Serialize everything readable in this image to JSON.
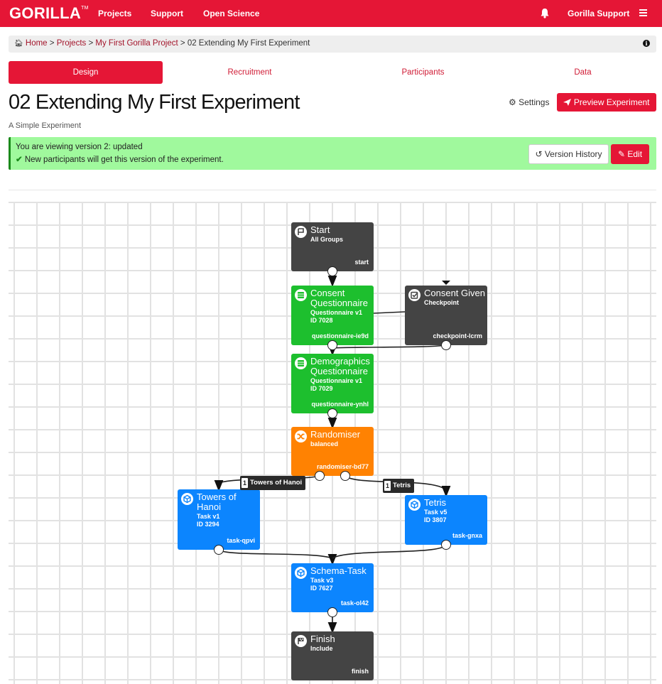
{
  "navbar": {
    "brand": "GORILLA",
    "brand_tm": "TM",
    "links": [
      "Projects",
      "Support",
      "Open Science"
    ],
    "user": "Gorilla Support",
    "bell_icon": "bell-icon",
    "menu_icon": "hamburger-menu-icon"
  },
  "breadcrumb": {
    "home_icon": "home-icon",
    "items": [
      "Home",
      "Projects",
      "My First Gorilla Project"
    ],
    "current": "02 Extending My First Experiment",
    "separator": ">",
    "info_icon": "info-icon"
  },
  "tabs": [
    {
      "label": "Design",
      "active": true
    },
    {
      "label": "Recruitment",
      "active": false
    },
    {
      "label": "Participants",
      "active": false
    },
    {
      "label": "Data",
      "active": false
    }
  ],
  "header": {
    "title": "02 Extending My First Experiment",
    "subtitle": "A Simple Experiment",
    "settings_label": "Settings",
    "preview_label": "Preview Experiment"
  },
  "alert": {
    "line1": "You are viewing version 2: updated",
    "line2": "New participants will get this version of the experiment.",
    "version_history_label": "Version History",
    "edit_label": "Edit"
  },
  "colors": {
    "brand": "#E51636",
    "alert_bg": "#A0F99D",
    "node_dark": "#444444",
    "node_questionnaire": "#1DBF2E",
    "node_randomiser": "#FF8202",
    "node_task": "#0C85FE"
  },
  "nodes": [
    {
      "id": "start",
      "title": "Start",
      "subtitle": "All Groups",
      "key": "start",
      "type": "start"
    },
    {
      "id": "consent",
      "title": "Consent Questionnaire",
      "subtitle": "Questionnaire v1",
      "extra": "ID 7028",
      "key": "questionnaire-ie9d",
      "type": "questionnaire"
    },
    {
      "id": "checkpoint",
      "title": "Consent Given",
      "subtitle": "Checkpoint",
      "key": "checkpoint-lcrm",
      "type": "checkpoint"
    },
    {
      "id": "demographics",
      "title": "Demographics Questionnaire",
      "subtitle": "Questionnaire v1",
      "extra": "ID 7029",
      "key": "questionnaire-ynhl",
      "type": "questionnaire"
    },
    {
      "id": "randomiser",
      "title": "Randomiser",
      "subtitle": "balanced",
      "key": "randomiser-bd77",
      "type": "randomiser"
    },
    {
      "id": "hanoi",
      "title": "Towers of Hanoi",
      "subtitle": "Task v1",
      "extra": "ID 3294",
      "key": "task-qpvi",
      "type": "task"
    },
    {
      "id": "tetris",
      "title": "Tetris",
      "subtitle": "Task v5",
      "extra": "ID 3807",
      "key": "task-gnxa",
      "type": "task"
    },
    {
      "id": "schema",
      "title": "Schema-Task",
      "subtitle": "Task v3",
      "extra": "ID 7627",
      "key": "task-ol42",
      "type": "task"
    },
    {
      "id": "finish",
      "title": "Finish",
      "subtitle": "Include",
      "key": "finish",
      "type": "finish"
    }
  ],
  "edge_labels": [
    {
      "weight": "1",
      "label": "Towers of Hanoi"
    },
    {
      "weight": "1",
      "label": "Tetris"
    }
  ]
}
